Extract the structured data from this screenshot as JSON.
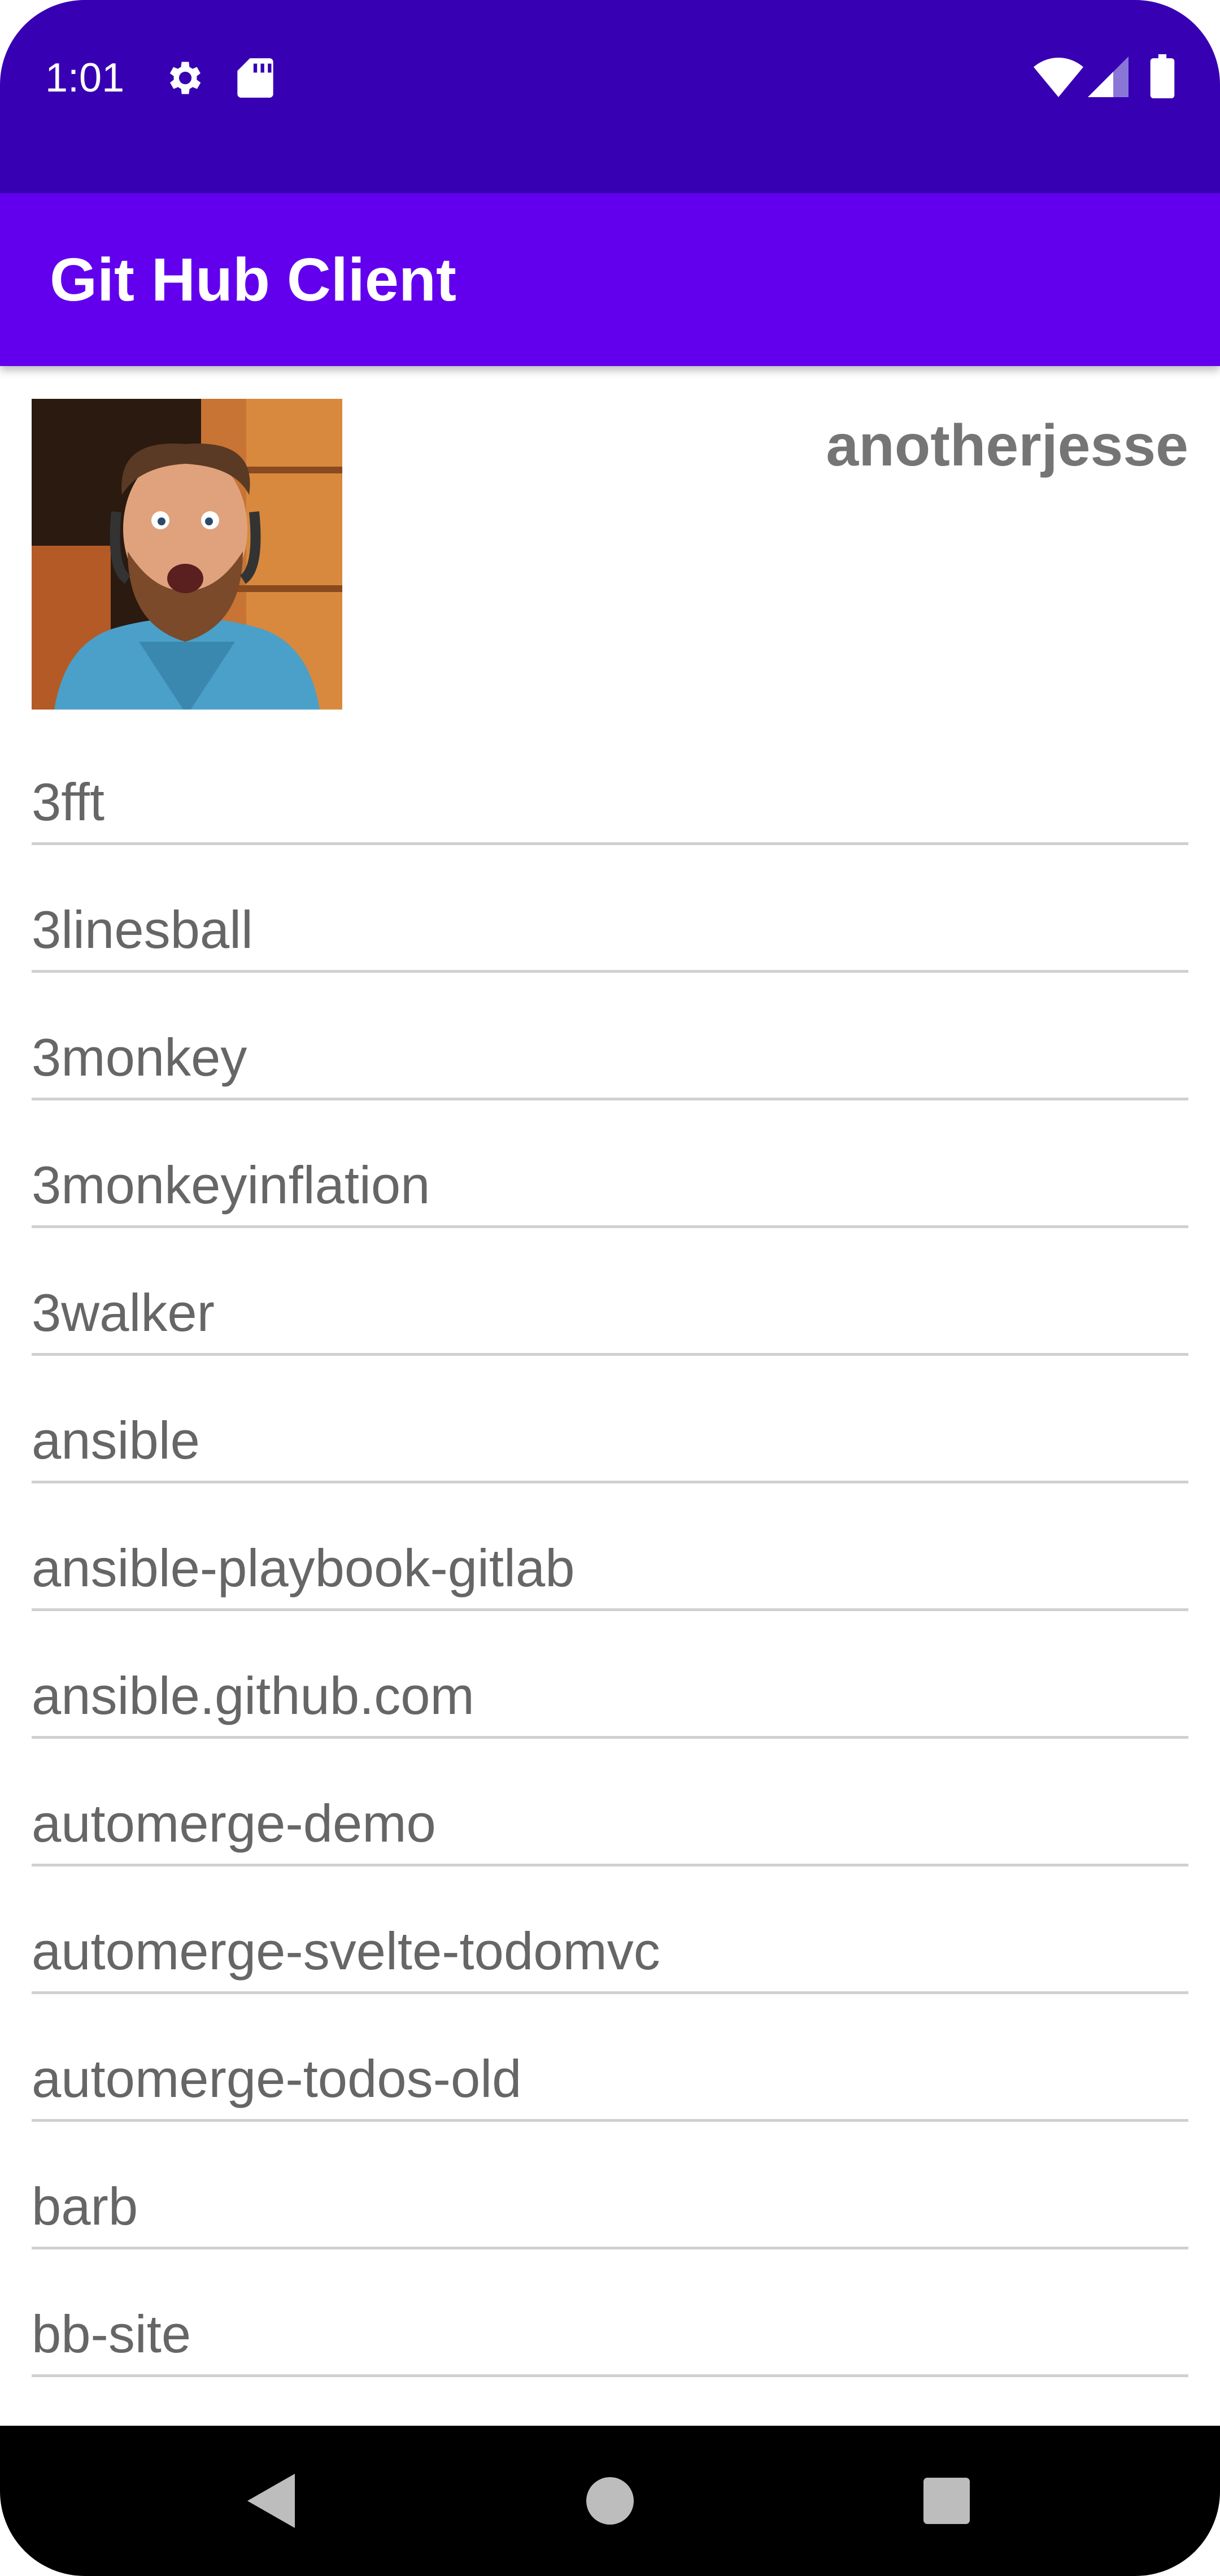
{
  "status_bar": {
    "time": "1:01",
    "icons": [
      "settings-icon",
      "sd-card-icon",
      "wifi-icon",
      "signal-icon",
      "battery-icon"
    ]
  },
  "app_bar": {
    "title": "Git Hub Client"
  },
  "profile": {
    "username": "anotherjesse",
    "avatar": "user-avatar-photo"
  },
  "repos": [
    "3fft",
    "3linesball",
    "3monkey",
    "3monkeyinflation",
    "3walker",
    "ansible",
    "ansible-playbook-gitlab",
    "ansible.github.com",
    "automerge-demo",
    "automerge-svelte-todomvc",
    "automerge-todos-old",
    "barb",
    "bb-site"
  ],
  "nav_bar": {
    "buttons": [
      "back-icon",
      "home-icon",
      "recents-icon"
    ]
  },
  "colors": {
    "status_bar": "#3700B3",
    "app_bar": "#6200EE",
    "text_secondary": "#666666"
  }
}
